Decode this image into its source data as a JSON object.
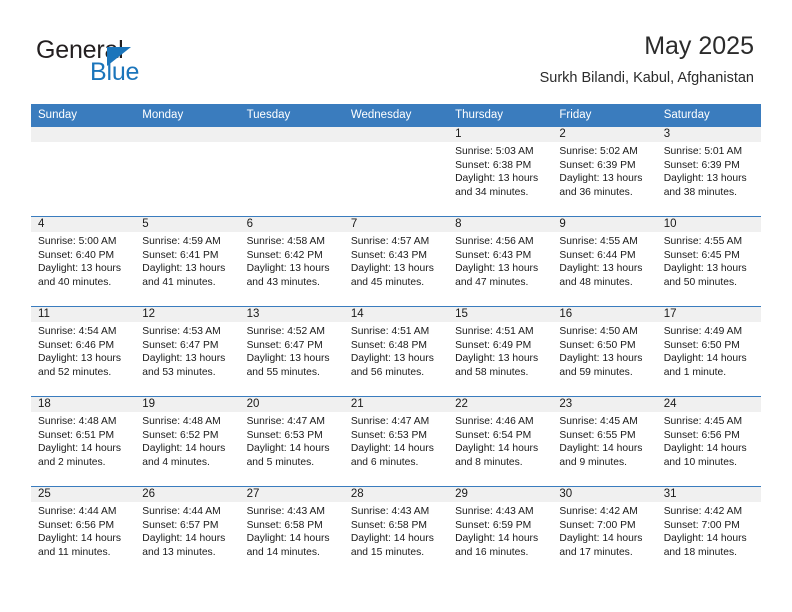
{
  "brand": {
    "word_primary": "General",
    "word_secondary": "Blue",
    "triangle_icon": "triangle-icon"
  },
  "header": {
    "title": "May 2025",
    "subtitle": "Surkh Bilandi, Kabul, Afghanistan"
  },
  "colors": {
    "header_blue": "#3a7cbe",
    "brand_blue": "#1b75bb",
    "daynum_strip": "#f0f0f0",
    "text": "#1a1a1a"
  },
  "calendar": {
    "weekday_headers": [
      "Sunday",
      "Monday",
      "Tuesday",
      "Wednesday",
      "Thursday",
      "Friday",
      "Saturday"
    ],
    "weeks": [
      [
        {
          "day": "",
          "lines": []
        },
        {
          "day": "",
          "lines": []
        },
        {
          "day": "",
          "lines": []
        },
        {
          "day": "",
          "lines": []
        },
        {
          "day": "1",
          "lines": [
            "Sunrise: 5:03 AM",
            "Sunset: 6:38 PM",
            "Daylight: 13 hours",
            "and 34 minutes."
          ]
        },
        {
          "day": "2",
          "lines": [
            "Sunrise: 5:02 AM",
            "Sunset: 6:39 PM",
            "Daylight: 13 hours",
            "and 36 minutes."
          ]
        },
        {
          "day": "3",
          "lines": [
            "Sunrise: 5:01 AM",
            "Sunset: 6:39 PM",
            "Daylight: 13 hours",
            "and 38 minutes."
          ]
        }
      ],
      [
        {
          "day": "4",
          "lines": [
            "Sunrise: 5:00 AM",
            "Sunset: 6:40 PM",
            "Daylight: 13 hours",
            "and 40 minutes."
          ]
        },
        {
          "day": "5",
          "lines": [
            "Sunrise: 4:59 AM",
            "Sunset: 6:41 PM",
            "Daylight: 13 hours",
            "and 41 minutes."
          ]
        },
        {
          "day": "6",
          "lines": [
            "Sunrise: 4:58 AM",
            "Sunset: 6:42 PM",
            "Daylight: 13 hours",
            "and 43 minutes."
          ]
        },
        {
          "day": "7",
          "lines": [
            "Sunrise: 4:57 AM",
            "Sunset: 6:43 PM",
            "Daylight: 13 hours",
            "and 45 minutes."
          ]
        },
        {
          "day": "8",
          "lines": [
            "Sunrise: 4:56 AM",
            "Sunset: 6:43 PM",
            "Daylight: 13 hours",
            "and 47 minutes."
          ]
        },
        {
          "day": "9",
          "lines": [
            "Sunrise: 4:55 AM",
            "Sunset: 6:44 PM",
            "Daylight: 13 hours",
            "and 48 minutes."
          ]
        },
        {
          "day": "10",
          "lines": [
            "Sunrise: 4:55 AM",
            "Sunset: 6:45 PM",
            "Daylight: 13 hours",
            "and 50 minutes."
          ]
        }
      ],
      [
        {
          "day": "11",
          "lines": [
            "Sunrise: 4:54 AM",
            "Sunset: 6:46 PM",
            "Daylight: 13 hours",
            "and 52 minutes."
          ]
        },
        {
          "day": "12",
          "lines": [
            "Sunrise: 4:53 AM",
            "Sunset: 6:47 PM",
            "Daylight: 13 hours",
            "and 53 minutes."
          ]
        },
        {
          "day": "13",
          "lines": [
            "Sunrise: 4:52 AM",
            "Sunset: 6:47 PM",
            "Daylight: 13 hours",
            "and 55 minutes."
          ]
        },
        {
          "day": "14",
          "lines": [
            "Sunrise: 4:51 AM",
            "Sunset: 6:48 PM",
            "Daylight: 13 hours",
            "and 56 minutes."
          ]
        },
        {
          "day": "15",
          "lines": [
            "Sunrise: 4:51 AM",
            "Sunset: 6:49 PM",
            "Daylight: 13 hours",
            "and 58 minutes."
          ]
        },
        {
          "day": "16",
          "lines": [
            "Sunrise: 4:50 AM",
            "Sunset: 6:50 PM",
            "Daylight: 13 hours",
            "and 59 minutes."
          ]
        },
        {
          "day": "17",
          "lines": [
            "Sunrise: 4:49 AM",
            "Sunset: 6:50 PM",
            "Daylight: 14 hours",
            "and 1 minute."
          ]
        }
      ],
      [
        {
          "day": "18",
          "lines": [
            "Sunrise: 4:48 AM",
            "Sunset: 6:51 PM",
            "Daylight: 14 hours",
            "and 2 minutes."
          ]
        },
        {
          "day": "19",
          "lines": [
            "Sunrise: 4:48 AM",
            "Sunset: 6:52 PM",
            "Daylight: 14 hours",
            "and 4 minutes."
          ]
        },
        {
          "day": "20",
          "lines": [
            "Sunrise: 4:47 AM",
            "Sunset: 6:53 PM",
            "Daylight: 14 hours",
            "and 5 minutes."
          ]
        },
        {
          "day": "21",
          "lines": [
            "Sunrise: 4:47 AM",
            "Sunset: 6:53 PM",
            "Daylight: 14 hours",
            "and 6 minutes."
          ]
        },
        {
          "day": "22",
          "lines": [
            "Sunrise: 4:46 AM",
            "Sunset: 6:54 PM",
            "Daylight: 14 hours",
            "and 8 minutes."
          ]
        },
        {
          "day": "23",
          "lines": [
            "Sunrise: 4:45 AM",
            "Sunset: 6:55 PM",
            "Daylight: 14 hours",
            "and 9 minutes."
          ]
        },
        {
          "day": "24",
          "lines": [
            "Sunrise: 4:45 AM",
            "Sunset: 6:56 PM",
            "Daylight: 14 hours",
            "and 10 minutes."
          ]
        }
      ],
      [
        {
          "day": "25",
          "lines": [
            "Sunrise: 4:44 AM",
            "Sunset: 6:56 PM",
            "Daylight: 14 hours",
            "and 11 minutes."
          ]
        },
        {
          "day": "26",
          "lines": [
            "Sunrise: 4:44 AM",
            "Sunset: 6:57 PM",
            "Daylight: 14 hours",
            "and 13 minutes."
          ]
        },
        {
          "day": "27",
          "lines": [
            "Sunrise: 4:43 AM",
            "Sunset: 6:58 PM",
            "Daylight: 14 hours",
            "and 14 minutes."
          ]
        },
        {
          "day": "28",
          "lines": [
            "Sunrise: 4:43 AM",
            "Sunset: 6:58 PM",
            "Daylight: 14 hours",
            "and 15 minutes."
          ]
        },
        {
          "day": "29",
          "lines": [
            "Sunrise: 4:43 AM",
            "Sunset: 6:59 PM",
            "Daylight: 14 hours",
            "and 16 minutes."
          ]
        },
        {
          "day": "30",
          "lines": [
            "Sunrise: 4:42 AM",
            "Sunset: 7:00 PM",
            "Daylight: 14 hours",
            "and 17 minutes."
          ]
        },
        {
          "day": "31",
          "lines": [
            "Sunrise: 4:42 AM",
            "Sunset: 7:00 PM",
            "Daylight: 14 hours",
            "and 18 minutes."
          ]
        }
      ]
    ]
  }
}
